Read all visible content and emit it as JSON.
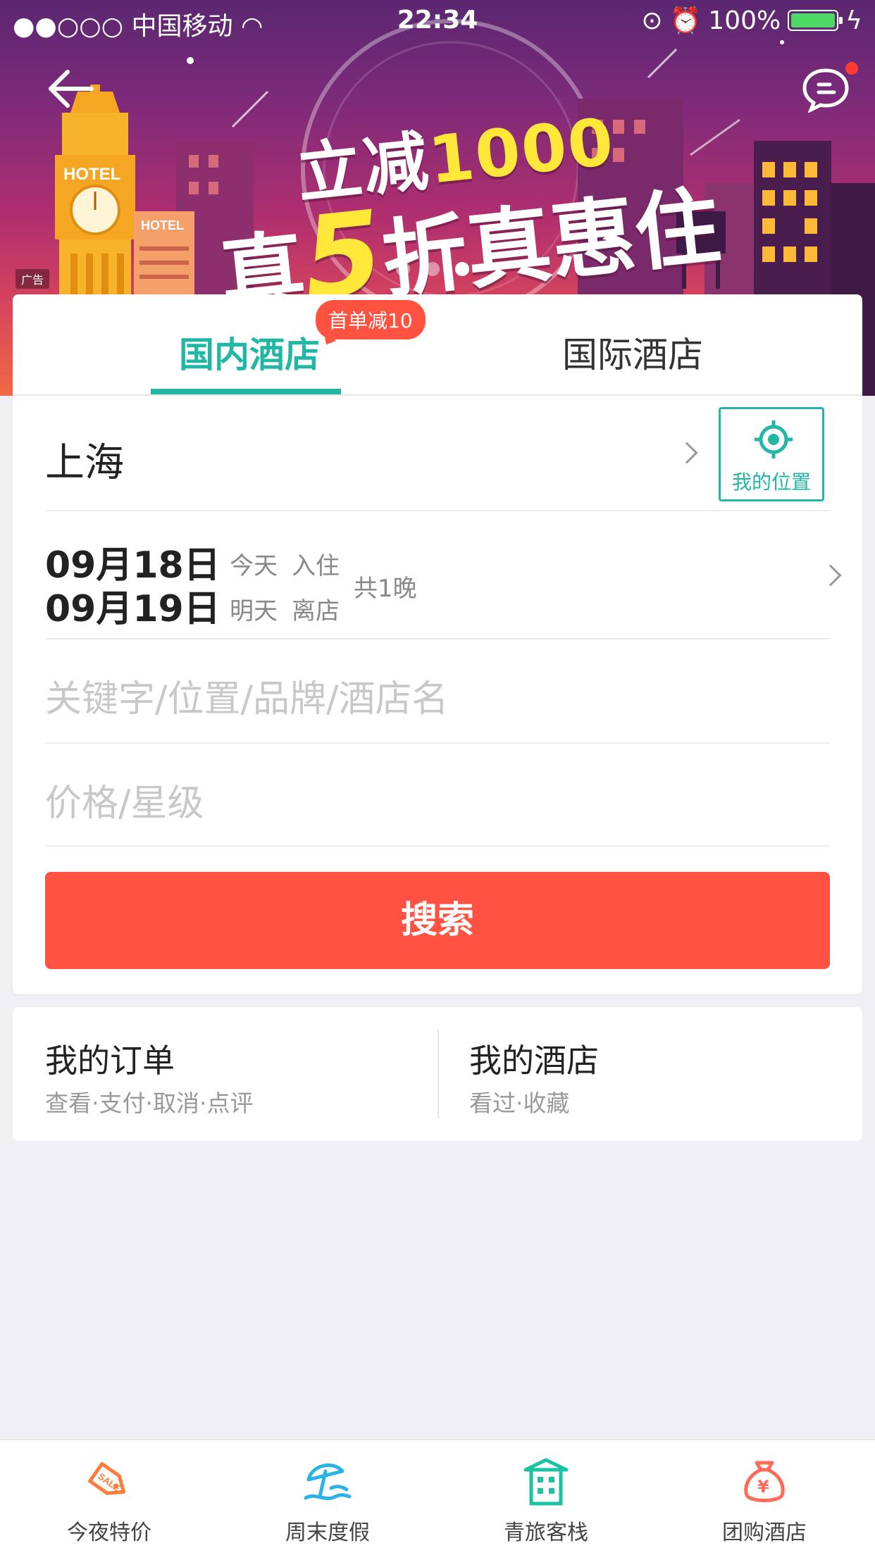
{
  "status_bar": {
    "carrier": "●●○○○ 中国移动",
    "time": "22:34",
    "battery": "100%"
  },
  "banner": {
    "line1_prefix": "立减",
    "line1_amount": "1000",
    "line2_prefix": "真",
    "line2_num": "5",
    "line2_suffix": "折真惠住",
    "hotel_sign1": "HOTEL",
    "hotel_sign2": "HOTEL",
    "ad_label": "广告"
  },
  "tabs": [
    {
      "label": "国内酒店",
      "active": true
    },
    {
      "label": "国际酒店",
      "active": false
    }
  ],
  "tab_badge": "首单减10",
  "search_form": {
    "city": "上海",
    "my_location_label": "我的位置",
    "checkin_date": "09月18日",
    "checkin_day": "今天",
    "checkin_label": "入住",
    "checkout_date": "09月19日",
    "checkout_day": "明天",
    "checkout_label": "离店",
    "nights": "共1晚",
    "keyword_placeholder": "关键字/位置/品牌/酒店名",
    "price_placeholder": "价格/星级",
    "search_button": "搜索"
  },
  "shortcuts": {
    "orders_title": "我的订单",
    "orders_sub": "查看·支付·取消·点评",
    "hotels_title": "我的酒店",
    "hotels_sub": "看过·收藏"
  },
  "bottom_nav": [
    {
      "label": "今夜特价",
      "icon": "sale-tag-icon",
      "color": "#ff7a3d"
    },
    {
      "label": "周末度假",
      "icon": "beach-umbrella-icon",
      "color": "#2bb3e8"
    },
    {
      "label": "青旅客栈",
      "icon": "inn-building-icon",
      "color": "#19c2a3"
    },
    {
      "label": "团购酒店",
      "icon": "money-bag-icon",
      "color": "#ff6b5a"
    }
  ],
  "colors": {
    "accent_teal": "#22b7a5",
    "search_red": "#ff5242",
    "banner_yellow": "#ffe83a"
  }
}
